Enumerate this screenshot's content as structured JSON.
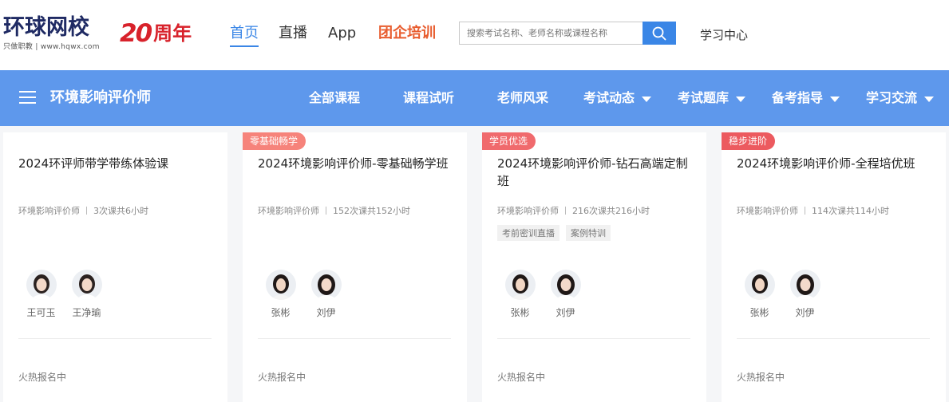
{
  "header": {
    "logo_main": "环球网校",
    "logo_sub": "只做职教 | www.hqwx.com",
    "anniversary_number": "20",
    "anniversary_text": "周年",
    "nav": [
      {
        "label": "首页"
      },
      {
        "label": "直播"
      },
      {
        "label": "App"
      },
      {
        "label": "团企培训"
      }
    ],
    "search_placeholder": "搜索考试名称、老师名称或课程名称",
    "study_center": "学习中心"
  },
  "subnav": {
    "title": "环境影响评价师",
    "items": [
      {
        "label": "全部课程"
      },
      {
        "label": "课程试听"
      },
      {
        "label": "老师风采"
      },
      {
        "label": "考试动态"
      },
      {
        "label": "考试题库"
      },
      {
        "label": "备考指导"
      },
      {
        "label": "学习交流"
      }
    ]
  },
  "cards": [
    {
      "badge": "",
      "title": "2024环评师带学带练体验课",
      "category": "环境影响评价师",
      "lessons": "3次课共6小时",
      "tags": [],
      "teachers": [
        {
          "name": "王可玉"
        },
        {
          "name": "王净瑜"
        }
      ],
      "status": "火热报名中"
    },
    {
      "badge": "零基础畅学",
      "title": "2024环境影响评价师-零基础畅学班",
      "category": "环境影响评价师",
      "lessons": "152次课共152小时",
      "tags": [],
      "teachers": [
        {
          "name": "张彬"
        },
        {
          "name": "刘伊"
        }
      ],
      "status": "火热报名中"
    },
    {
      "badge": "学员优选",
      "title": "2024环境影响评价师-钻石高端定制班",
      "category": "环境影响评价师",
      "lessons": "216次课共216小时",
      "tags": [
        "考前密训直播",
        "案例特训"
      ],
      "teachers": [
        {
          "name": "张彬"
        },
        {
          "name": "刘伊"
        }
      ],
      "status": "火热报名中"
    },
    {
      "badge": "稳步进阶",
      "title": "2024环境影响评价师-全程培优班",
      "category": "环境影响评价师",
      "lessons": "114次课共114小时",
      "tags": [],
      "teachers": [
        {
          "name": "张彬"
        },
        {
          "name": "刘伊"
        }
      ],
      "status": "火热报名中"
    }
  ],
  "colors": {
    "brand_blue": "#3a86e6",
    "subnav_blue": "#5e98ec",
    "hot_orange": "#e85d2f",
    "anniversary_red": "#d8222b",
    "badge_red": "#f06a6d"
  }
}
